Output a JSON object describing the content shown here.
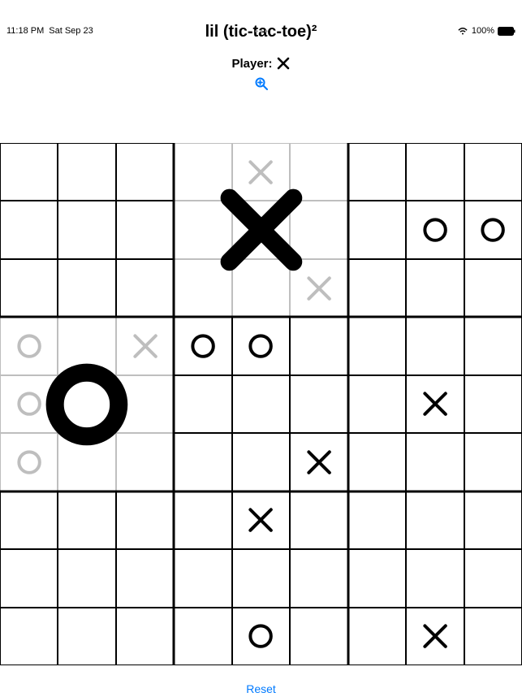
{
  "status": {
    "time": "11:18 PM",
    "date": "Sat Sep 23",
    "battery": "100%"
  },
  "title": "lil (tic-tac-toe)²",
  "player_label": "Player:",
  "current_player": "X",
  "zoom_icon": "zoom-in",
  "reset_label": "Reset",
  "board": {
    "comment": "9 super-cells each 3x3; winner indicates big-mark over super-cell; faded true = dimmed lines & marks",
    "supercells": [
      {
        "winner": null,
        "faded": false,
        "cells": [
          "",
          "",
          "",
          "",
          "",
          "",
          "",
          "",
          ""
        ]
      },
      {
        "winner": "X",
        "faded": true,
        "cells": [
          "",
          "X",
          "",
          "",
          "",
          "",
          "",
          "",
          "X"
        ]
      },
      {
        "winner": null,
        "faded": false,
        "cells": [
          "",
          "",
          "",
          "",
          "O",
          "O",
          "",
          "",
          ""
        ]
      },
      {
        "winner": "O",
        "faded": true,
        "cells": [
          "O",
          "",
          "X",
          "O",
          "",
          "",
          "O",
          "",
          ""
        ]
      },
      {
        "winner": null,
        "faded": false,
        "cells": [
          "O",
          "O",
          "",
          "",
          "",
          "",
          "",
          "",
          "X"
        ]
      },
      {
        "winner": null,
        "faded": false,
        "cells": [
          "",
          "",
          "",
          "",
          "X",
          "",
          "",
          "",
          ""
        ]
      },
      {
        "winner": null,
        "faded": false,
        "cells": [
          "",
          "",
          "",
          "",
          "",
          "",
          "",
          "",
          ""
        ]
      },
      {
        "winner": null,
        "faded": false,
        "cells": [
          "",
          "X",
          "",
          "",
          "",
          "",
          "",
          "O",
          ""
        ]
      },
      {
        "winner": null,
        "faded": false,
        "cells": [
          "",
          "",
          "",
          "",
          "",
          "",
          "",
          "X",
          ""
        ]
      }
    ]
  }
}
